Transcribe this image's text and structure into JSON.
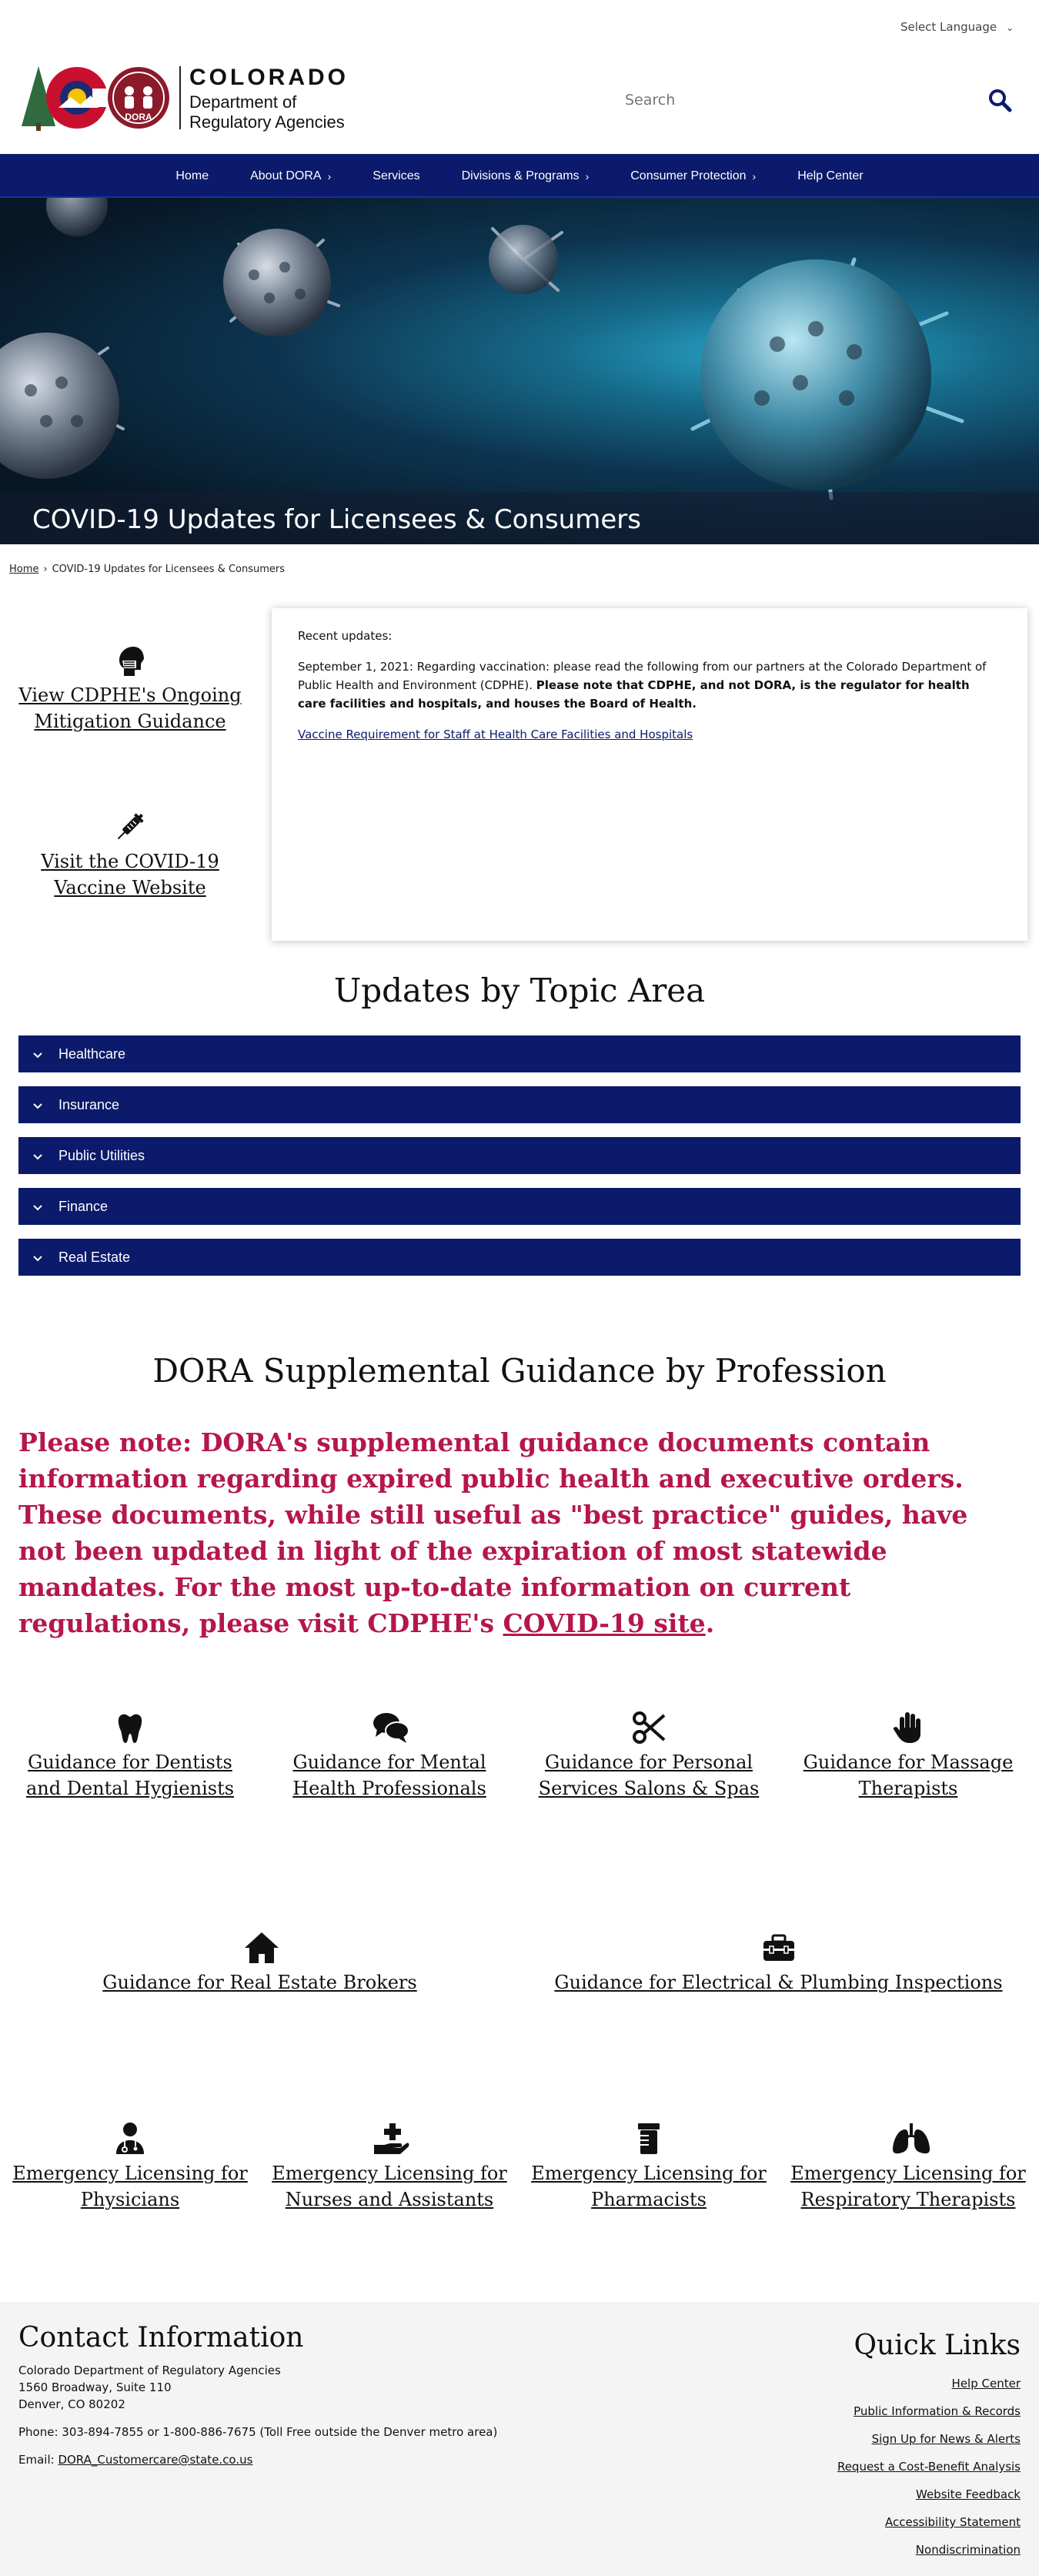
{
  "header": {
    "language_label": "Select Language",
    "logo_state": "COLORADO",
    "logo_dept_line1": "Department of",
    "logo_dept_line2": "Regulatory Agencies",
    "logo_badge": "DORA",
    "search_placeholder": "Search"
  },
  "nav": {
    "items": [
      {
        "label": "Home"
      },
      {
        "label": "About DORA"
      },
      {
        "label": "Services"
      },
      {
        "label": "Divisions & Programs"
      },
      {
        "label": "Consumer Protection"
      },
      {
        "label": "Help Center"
      }
    ]
  },
  "hero": {
    "title": "COVID-19 Updates for Licensees & Consumers"
  },
  "breadcrumb": {
    "home": "Home",
    "separator": "›",
    "current": "COVID-19 Updates for Licensees & Consumers"
  },
  "side_links": {
    "mitigation": "View CDPHE's Ongoing Mitigation Guidance",
    "vaccine": "Visit the COVID-19 Vaccine Website"
  },
  "updates_card": {
    "heading": "Recent updates:",
    "body_plain": "September 1, 2021: Regarding vaccination: please read the following from our partners at the Colorado Department of Public Health and Environment (CDPHE). ",
    "body_bold": "Please note that CDPHE, and not DORA, is the regulator for health care facilities and hospitals, and houses the Board of Health.",
    "link": "Vaccine Requirement for Staff at Health Care Facilities and Hospitals"
  },
  "topics": {
    "heading": "Updates by Topic Area",
    "items": [
      {
        "label": "Healthcare"
      },
      {
        "label": "Insurance"
      },
      {
        "label": "Public Utilities"
      },
      {
        "label": "Finance"
      },
      {
        "label": "Real Estate"
      }
    ]
  },
  "supplemental": {
    "heading": "DORA Supplemental Guidance by Profession",
    "notice": "Please note: DORA's supplemental guidance documents contain information regarding expired public health and executive orders. These documents, while still useful as \"best practice\" guides, have not been updated in light of the expiration of most statewide mandates. For the most up-to-date information on current regulations, please visit CDPHE's ",
    "notice_link": "COVID-19 site",
    "notice_end": "."
  },
  "tiles": {
    "dentists": "Guidance for Dentists and Dental Hygienists",
    "mental": "Guidance for Mental Health Professionals",
    "salons": "Guidance for Personal Services Salons & Spas",
    "massage": "Guidance for Massage Therapists",
    "realestate": "Guidance for Real Estate Brokers",
    "electrical": "Guidance for Electrical & Plumbing Inspections",
    "physicians": "Emergency Licensing for Physicians",
    "nurses": "Emergency Licensing for Nurses and Assistants",
    "pharmacists": "Emergency Licensing for Pharmacists",
    "respiratory": "Emergency Licensing for Respiratory Therapists"
  },
  "footer": {
    "contact_heading": "Contact Information",
    "org": "Colorado Department of Regulatory Agencies",
    "address1": "1560 Broadway, Suite 110",
    "address2": "Denver, CO 80202",
    "phone": "Phone: 303-894-7855 or 1-800-886-7675 (Toll Free outside the Denver metro area)",
    "email_label": "Email: ",
    "email": "DORA_Customercare@state.co.us",
    "quick_heading": "Quick Links",
    "quick_links": [
      {
        "label": "Help Center"
      },
      {
        "label": "Public Information & Records"
      },
      {
        "label": "Sign Up for News & Alerts"
      },
      {
        "label": "Request a Cost-Benefit Analysis"
      },
      {
        "label": "Website Feedback"
      },
      {
        "label": "Accessibility Statement"
      },
      {
        "label": "Nondiscrimination"
      }
    ]
  },
  "colors": {
    "navy": "#0b1a6b",
    "notice_red": "#b5164d",
    "footer_bg": "#f4f4f4"
  }
}
